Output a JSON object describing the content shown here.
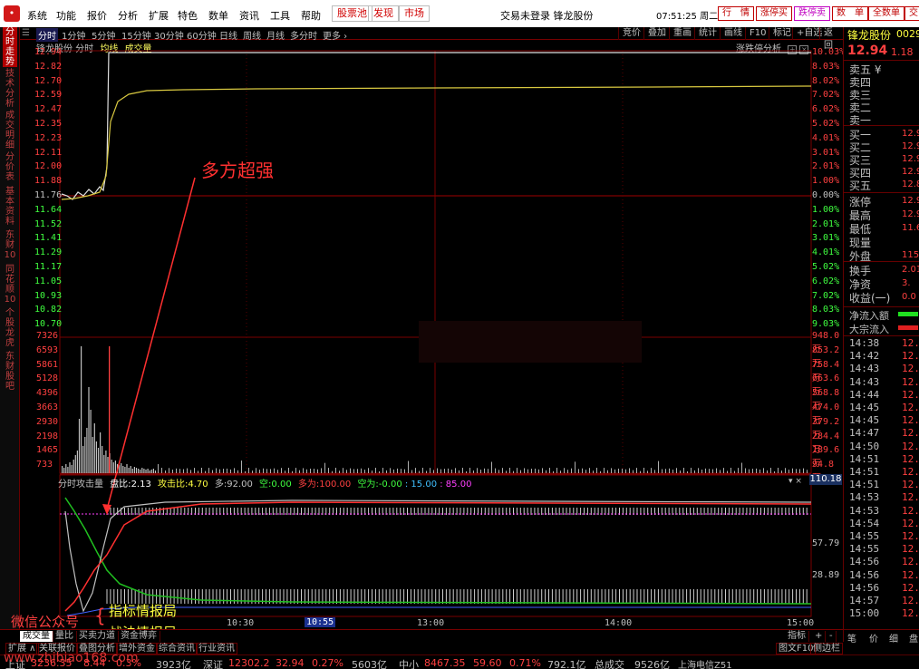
{
  "menubar": {
    "logo": "•",
    "items": [
      "系统",
      "功能",
      "报价",
      "分析",
      "扩展",
      "特色",
      "数单",
      "资讯",
      "工具",
      "帮助"
    ],
    "boxes": [
      "股票池",
      "发现",
      "市场"
    ],
    "center": "交易未登录  锋龙股份",
    "clock": "07:51:25 周二",
    "buttons": [
      "行　情",
      "涨停买",
      "跌停卖",
      "数　单",
      "全数单",
      "交"
    ]
  },
  "sidebar": [
    "分时走势",
    "技术分析",
    "成交明细",
    "分价表",
    "基本资料",
    "东财10",
    "同花顺10",
    "个股龙虎",
    "东财股吧"
  ],
  "periodbar": {
    "items": [
      "分时",
      "1分钟",
      "5分钟",
      "15分钟",
      "30分钟",
      "60分钟",
      "日线",
      "周线",
      "月线",
      "多分时",
      "更多 ›"
    ],
    "tools": [
      "竞价",
      "叠加",
      "重画",
      "统计",
      "画线",
      "F10",
      "标记",
      "+自选",
      "返回"
    ]
  },
  "chart": {
    "title": "锋龙股份  分时",
    "avg_label": "均线",
    "vol_label": "成交量",
    "analysis_label": "涨跌停分析",
    "annotation": "多方超强",
    "price_labels": [
      "12.94",
      "12.82",
      "12.70",
      "12.59",
      "12.47",
      "12.35",
      "12.23",
      "12.11",
      "12.00",
      "11.88",
      "11.76",
      "11.64",
      "11.52",
      "11.41",
      "11.29",
      "11.17",
      "11.05",
      "10.93",
      "10.82",
      "10.70"
    ],
    "pct_labels": [
      "10.03%",
      "8.03%",
      "8.02%",
      "7.02%",
      "6.02%",
      "5.02%",
      "4.01%",
      "3.01%",
      "2.01%",
      "1.00%",
      "0.00%",
      "1.00%",
      "2.01%",
      "3.01%",
      "4.01%",
      "5.02%",
      "6.02%",
      "7.02%",
      "8.03%",
      "9.03%"
    ],
    "vol_labels": [
      "7326",
      "6593",
      "5861",
      "5128",
      "4396",
      "3663",
      "2930",
      "2198",
      "1465",
      "733"
    ],
    "vol_right_labels": [
      "948.0万",
      "853.2万",
      "758.4万",
      "663.6万",
      "568.8万",
      "474.0万",
      "379.2万",
      "284.4万",
      "189.6万",
      "94.8万"
    ],
    "indicator_header": {
      "name": "分时攻击量",
      "a_label": "盘比:",
      "a": "2.13",
      "b_label": "攻击比:",
      "b": "4.70",
      "c_label": "多:",
      "c": "92.00",
      "d_label": "空:",
      "d": "0.00",
      "e_label": "多为:",
      "e": "100.00",
      "f_label": "空为:",
      "f": "-0.00",
      "g": ": 15.00",
      "h": ": 85.00"
    },
    "indicator_right": [
      "110.18",
      "57.79",
      "28.89"
    ],
    "time_labels": [
      "10:30",
      "10:55",
      "13:00",
      "14:00",
      "15:00"
    ],
    "watermark_left": "微信公众号",
    "watermark_a": "指标情报局",
    "watermark_b": "战法情报局",
    "watermark_url": "www.zhibiao168.com"
  },
  "rightpanel": {
    "name": "锋龙股份",
    "code": "0029",
    "price": "12.94",
    "change": "1.18",
    "sell": [
      "卖五 ¥",
      "卖四",
      "卖三",
      "卖二",
      "卖一"
    ],
    "buy": [
      "买一",
      "买二",
      "买三",
      "买四",
      "买五"
    ],
    "buy_vals": [
      "12.9",
      "12.9",
      "12.9",
      "12.9",
      "12.8"
    ],
    "stats": [
      "涨停",
      "最高",
      "最低",
      "现量",
      "外盘"
    ],
    "stat_vals": [
      "12.9",
      "12.9",
      "11.6",
      "",
      "115"
    ],
    "fund": [
      "换手",
      "净资",
      "收益(一)"
    ],
    "fund_vals": [
      "2.01",
      "3.",
      "0.0"
    ],
    "flow": [
      "净流入额",
      "大宗流入"
    ],
    "ticks": [
      [
        "14:38",
        "12.9"
      ],
      [
        "14:42",
        "12.9"
      ],
      [
        "14:43",
        "12.9"
      ],
      [
        "14:43",
        "12.9"
      ],
      [
        "14:44",
        "12.9"
      ],
      [
        "14:45",
        "12.9"
      ],
      [
        "14:45",
        "12.9"
      ],
      [
        "14:47",
        "12.9"
      ],
      [
        "14:50",
        "12.9"
      ],
      [
        "14:51",
        "12.9"
      ],
      [
        "14:51",
        "12.9"
      ],
      [
        "14:51",
        "12.9"
      ],
      [
        "14:53",
        "12.9"
      ],
      [
        "14:53",
        "12.9"
      ],
      [
        "14:54",
        "12.9"
      ],
      [
        "14:55",
        "12.9"
      ],
      [
        "14:55",
        "12.9"
      ],
      [
        "14:56",
        "12.9"
      ],
      [
        "14:56",
        "12.9"
      ],
      [
        "14:56",
        "12.9"
      ],
      [
        "14:57",
        "12.9"
      ],
      [
        "15:00",
        "12.9"
      ]
    ],
    "bottom_tabs": [
      "笔",
      "价",
      "细",
      "盘"
    ]
  },
  "bottomtabs": [
    "成交量",
    "量比",
    "买卖力道",
    "资金博弈"
  ],
  "bottomtabs_right": [
    "指标",
    "+",
    "-"
  ],
  "bottomtabs2": [
    "扩展 ∧",
    "关联报价",
    "叠图分析",
    "增外资金",
    "综合资讯",
    "行业资讯"
  ],
  "bottomtabs2_right": [
    "图文F10",
    "侧边栏"
  ],
  "statusbar": {
    "a": "上证",
    "a_val": "3236.35",
    "a_chg": "8.44",
    "a_pct": "0.3%",
    "a_amt": "3923亿",
    "b": "深证",
    "b_val": "12302.2",
    "b_chg": "32.94",
    "b_pct": "0.27%",
    "b_amt": "5603亿",
    "c": "中小",
    "c_val": "8467.35",
    "c_chg": "59.60",
    "c_pct": "0.71%",
    "c_amt": "792.1亿",
    "d": "总成交",
    "d_val": "9526亿",
    "e": "上海电信Z51"
  }
}
